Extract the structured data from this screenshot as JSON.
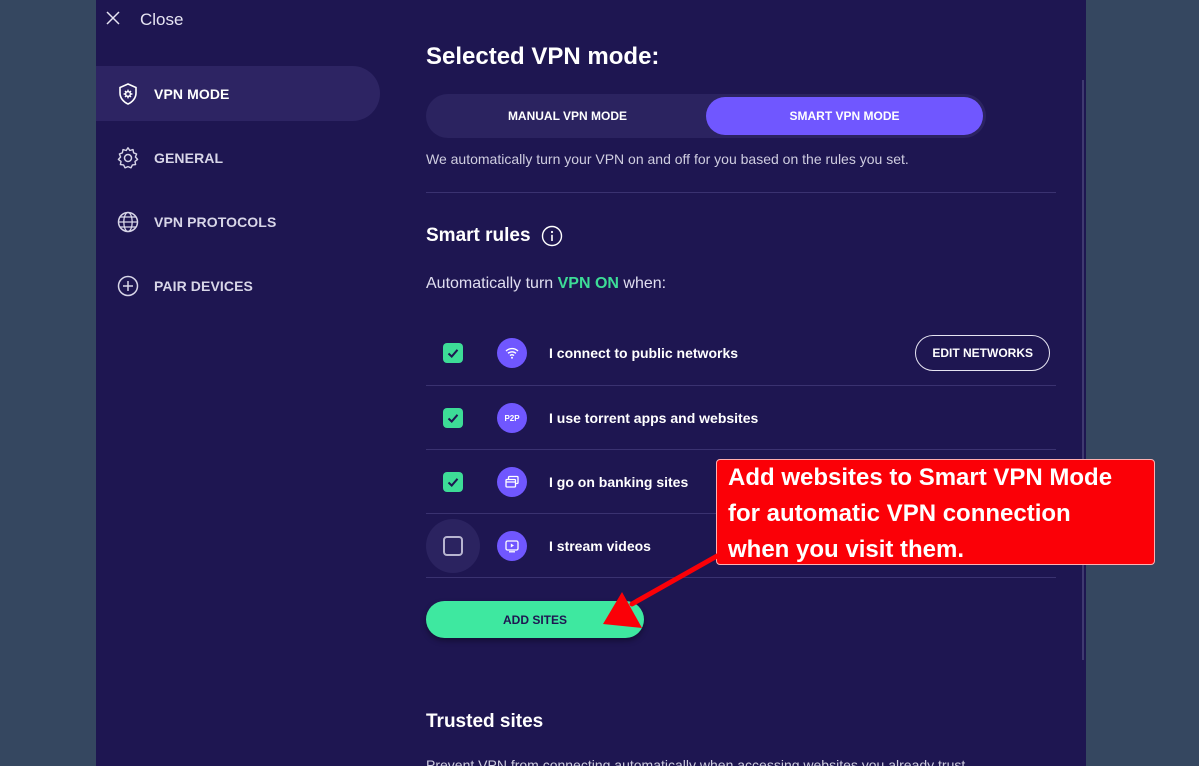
{
  "window": {
    "close_label": "Close"
  },
  "sidebar": {
    "items": [
      {
        "label": "VPN MODE",
        "icon": "shield-gear-icon",
        "active": true
      },
      {
        "label": "GENERAL",
        "icon": "gear-icon",
        "active": false
      },
      {
        "label": "VPN PROTOCOLS",
        "icon": "globe-icon",
        "active": false
      },
      {
        "label": "PAIR DEVICES",
        "icon": "plus-circle-icon",
        "active": false
      }
    ]
  },
  "main": {
    "title": "Selected VPN mode:",
    "modes": [
      {
        "label": "MANUAL VPN MODE",
        "selected": false
      },
      {
        "label": "SMART VPN MODE",
        "selected": true
      }
    ],
    "mode_description": "We automatically turn your VPN on and off for you based on the rules you set.",
    "smart_rules": {
      "title": "Smart rules",
      "intro_prefix": "Automatically turn ",
      "intro_highlight": "VPN ON",
      "intro_suffix": " when:",
      "rules": [
        {
          "label": "I connect to public networks",
          "checked": true,
          "icon": "public-wifi-icon"
        },
        {
          "label": "I use torrent apps and websites",
          "checked": true,
          "icon": "p2p-icon",
          "icon_text": "P2P"
        },
        {
          "label": "I go on banking sites",
          "checked": true,
          "icon": "bank-card-icon"
        },
        {
          "label": "I stream videos",
          "checked": false,
          "icon": "video-play-icon"
        }
      ],
      "edit_networks_label": "EDIT NETWORKS",
      "add_sites_label": "ADD SITES"
    },
    "trusted_sites": {
      "title": "Trusted sites",
      "description": "Prevent VPN from connecting automatically when accessing websites you already trust."
    }
  },
  "annotation": {
    "lines": [
      "Add websites to Smart VPN Mode",
      "for automatic VPN connection",
      "when you visit them."
    ]
  },
  "colors": {
    "background": "#354760",
    "panel": "#1e1651",
    "accent_purple": "#7057ff",
    "accent_green": "#3ddc97",
    "callout_red": "#fb0007"
  }
}
